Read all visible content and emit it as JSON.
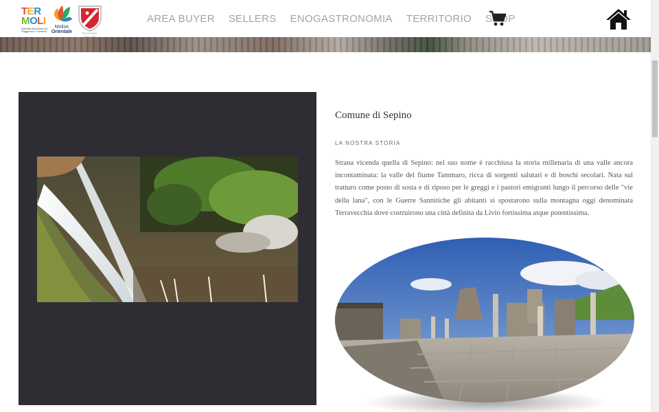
{
  "header": {
    "logo_termoli_line1": "TER",
    "logo_termoli_line2": "MOLI",
    "logo_termoli_tagline": "Azienda Autonoma di Soggiorno e Turismo",
    "logo_molise_line1": "Molise",
    "logo_molise_line2": "Orientale",
    "logo_shield_text": "REGIONE MOLISE",
    "nav": [
      {
        "label": "AREA BUYER"
      },
      {
        "label": "SELLERS"
      },
      {
        "label": "ENOGASTRONOMIA"
      },
      {
        "label": "TERRITORIO"
      },
      {
        "label": "SHOP"
      }
    ],
    "cart_icon": "shopping-cart-icon",
    "home_icon": "home-icon"
  },
  "content": {
    "title": "Comune di Sepino",
    "section_label": "LA NOSTRA STORIA",
    "story": "Strana vicenda quella di Sepino: nel suo nome è racchiusa la storia millenaria di una valle ancora incontaminata: la valle del fiume Tammaro, ricca di sorgenti salutari e di boschi secolari. Nata sul tratturo come posto di sosta e di riposo per le greggi e i pastori emigranti lungo il percorso delle \"vie della lana\", con le Guerre Sannitiche gli abitanti si spostarono sulla montagna oggi denominata Terravecchia dove costruirono una città definita da Livio fortissima atque potentissima."
  },
  "colors": {
    "nav_text": "#a3a3a3",
    "panel_dark": "#2e2d33",
    "body_text": "#555555",
    "termoli_t": "#e8452c",
    "termoli_e": "#f5a623",
    "termoli_r": "#1a8fd6",
    "termoli_m": "#7bb72c",
    "shield_red": "#d22730"
  }
}
